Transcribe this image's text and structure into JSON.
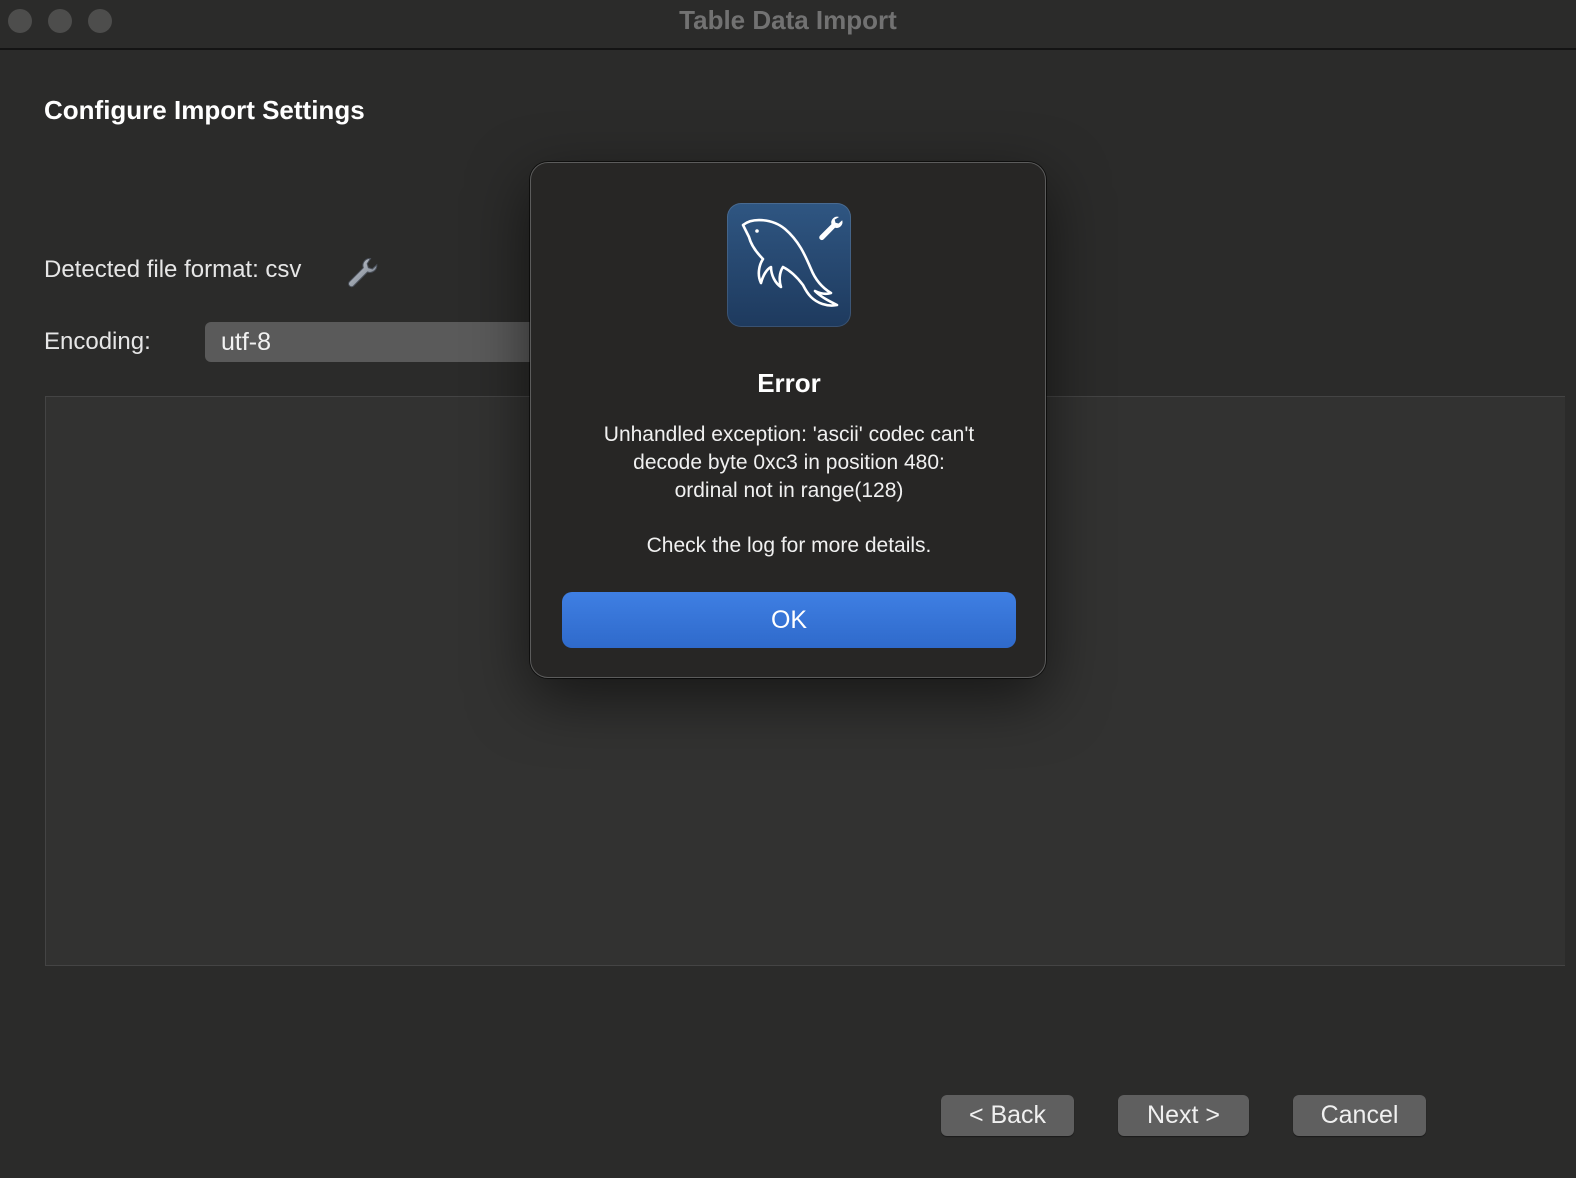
{
  "window": {
    "title": "Table Data Import"
  },
  "page": {
    "title": "Configure Import Settings",
    "detected_format_label": "Detected file format: csv",
    "encoding_label": "Encoding:",
    "encoding_value": "utf-8"
  },
  "buttons": {
    "back": "< Back",
    "next": "Next >",
    "cancel": "Cancel"
  },
  "dialog": {
    "title": "Error",
    "message_lines": [
      "Unhandled exception: 'ascii' codec can't",
      "decode byte 0xc3 in position 480:",
      "ordinal not in range(128)"
    ],
    "hint": "Check the log for more details.",
    "ok_label": "OK",
    "icon": "mysql-workbench-dolphin-icon"
  },
  "colors": {
    "background": "#2b2b2a",
    "accent": "#3a78dc",
    "icon_blue": "#2a4c75"
  }
}
